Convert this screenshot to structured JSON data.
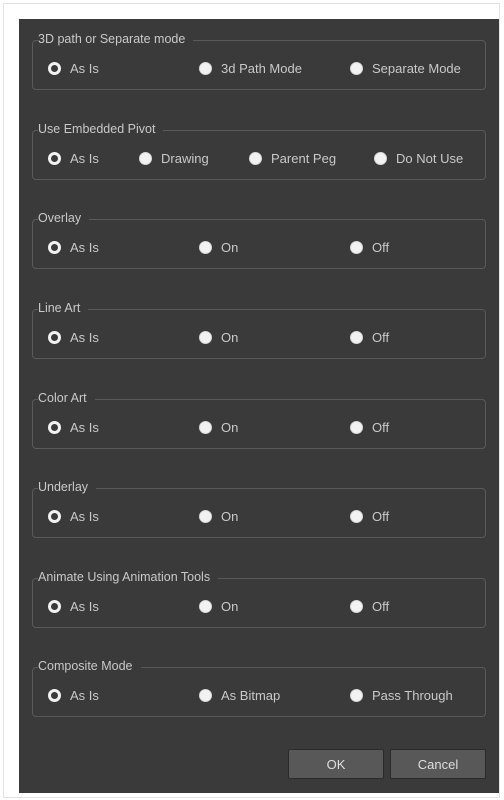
{
  "dialog": {
    "groups": [
      {
        "title": "3D path or Separate mode",
        "options": [
          "As Is",
          "3d Path Mode",
          "Separate Mode"
        ],
        "selected": 0
      },
      {
        "title": "Use Embedded Pivot",
        "options": [
          "As Is",
          "Drawing",
          "Parent Peg",
          "Do Not Use"
        ],
        "selected": 0
      },
      {
        "title": "Overlay",
        "options": [
          "As Is",
          "On",
          "Off"
        ],
        "selected": 0
      },
      {
        "title": "Line Art",
        "options": [
          "As Is",
          "On",
          "Off"
        ],
        "selected": 0
      },
      {
        "title": "Color Art",
        "options": [
          "As Is",
          "On",
          "Off"
        ],
        "selected": 0
      },
      {
        "title": "Underlay",
        "options": [
          "As Is",
          "On",
          "Off"
        ],
        "selected": 0
      },
      {
        "title": "Animate Using Animation Tools",
        "options": [
          "As Is",
          "On",
          "Off"
        ],
        "selected": 0
      },
      {
        "title": "Composite Mode",
        "options": [
          "As Is",
          "As Bitmap",
          "Pass Through"
        ],
        "selected": 0
      }
    ],
    "buttons": {
      "ok_label": "OK",
      "cancel_label": "Cancel"
    }
  },
  "colors": {
    "background": "#3a3a3a",
    "text": "#c9c9c9",
    "border": "#5a5a5a",
    "button": "#585858"
  }
}
